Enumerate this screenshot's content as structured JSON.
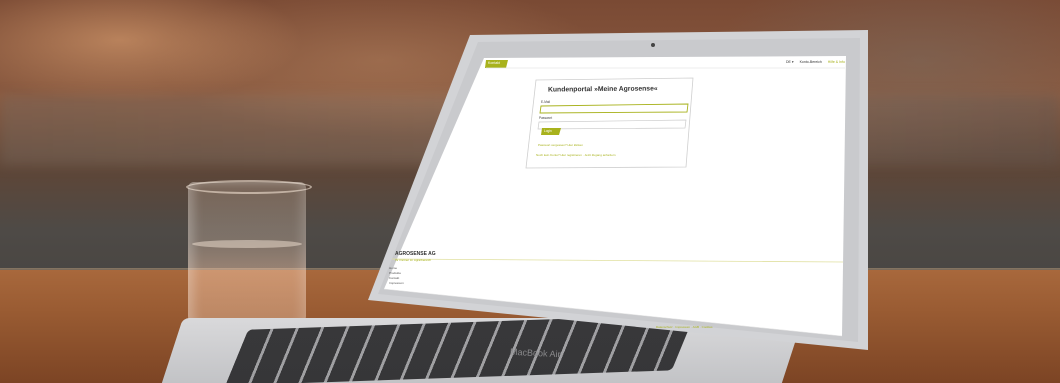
{
  "photo": {
    "laptop_brand": "MacBook Air"
  },
  "portal": {
    "title": "Kundenportal »Meine Agrosense«",
    "header_button": "Kontakt",
    "nav": [
      "DE ▾",
      "Konto-Bereich",
      "Hilfe & Info"
    ],
    "username_label": "E-Mail",
    "password_label": "Passwort",
    "login_button": "Login",
    "forgot_link": "Passwort vergessen? Hier klicken",
    "register_link": "Noch kein Konto? Hier registrieren · Jetzt Zugang anfordern",
    "footer_brand": "AGROSENSE AG",
    "footer_tagline": "Ihr Partner im Agrarbereich",
    "footer_items": [
      "Home",
      "Produkte",
      "Kontakt",
      "Impressum"
    ],
    "footer_right": "Datenschutz · Impressum · AGB · Cookies"
  },
  "colors": {
    "accent": "#a8b21c",
    "screen": "#ffffff",
    "card_border": "#cfcfcf"
  }
}
